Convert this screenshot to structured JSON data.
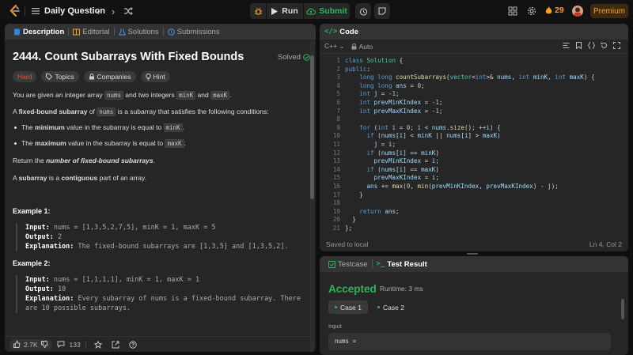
{
  "topbar": {
    "title": "Daily Question",
    "run_label": "Run",
    "submit_label": "Submit",
    "streak_count": "29",
    "premium_label": "Premium"
  },
  "description": {
    "tabs": [
      "Description",
      "Editorial",
      "Solutions",
      "Submissions"
    ],
    "title": "2444. Count Subarrays With Fixed Bounds",
    "solved_label": "Solved",
    "chips": [
      "Hard",
      "Topics",
      "Companies",
      "Hint"
    ],
    "p1_a": "You are given an integer array ",
    "p1_c1": "nums",
    "p1_b": " and two integers ",
    "p1_c2": "minK",
    "p1_d": " and ",
    "p1_c3": "maxK",
    "p1_e": ".",
    "p2_a": "A ",
    "p2_b": "fixed-bound subarray",
    "p2_c": " of ",
    "p2_code": "nums",
    "p2_d": " is a subarray that satisfies the following conditions:",
    "b1_a": "The ",
    "b1_b": "minimum",
    "b1_c": " value in the subarray is equal to ",
    "b1_code": "minK",
    "b1_d": ".",
    "b2_a": "The ",
    "b2_b": "maximum",
    "b2_c": " value in the subarray is equal to ",
    "b2_code": "maxK",
    "b2_d": ".",
    "p3_a": "Return the ",
    "p3_b": "number of fixed-bound subarrays",
    "p3_c": ".",
    "p4_a": "A ",
    "p4_b": "subarray",
    "p4_c": " is a ",
    "p4_d": "contiguous",
    "p4_e": " part of an array.",
    "examples": [
      {
        "title": "Example 1:",
        "input_label": "Input:",
        "input": " nums = [1,3,5,2,7,5], minK = 1, maxK = 5",
        "output_label": "Output:",
        "output": " 2",
        "expl_label": "Explanation:",
        "expl": " The fixed-bound subarrays are [1,3,5] and [1,3,5,2]."
      },
      {
        "title": "Example 2:",
        "input_label": "Input:",
        "input": " nums = [1,1,1,1], minK = 1, maxK = 1",
        "output_label": "Output:",
        "output": " 10",
        "expl_label": "Explanation:",
        "expl": " Every subarray of nums is a fixed-bound subarray. There",
        "expl2": "are 10 possible subarrays."
      }
    ],
    "footer": {
      "likes": "2.7K",
      "comments": "133"
    }
  },
  "code": {
    "panel_title": "Code",
    "language": "C++",
    "mode": "Auto",
    "lines": [
      "1",
      "2",
      "3",
      "4",
      "5",
      "6",
      "7",
      "8",
      "9",
      "10",
      "11",
      "12",
      "13",
      "14",
      "15",
      "16",
      "17",
      "18",
      "19",
      "20",
      "21"
    ],
    "status_left": "Saved to local",
    "status_right": "Ln 4, Col 2"
  },
  "result": {
    "tabs": [
      "Testcase",
      "Test Result"
    ],
    "verdict": "Accepted",
    "runtime": "Runtime: 3 ms",
    "cases": [
      "Case 1",
      "Case 2"
    ],
    "input_label": "Input",
    "input_value": "nums ="
  },
  "colors": {
    "accepted": "#2db55d",
    "hard": "#ef4743",
    "brand": "#ffa116"
  }
}
